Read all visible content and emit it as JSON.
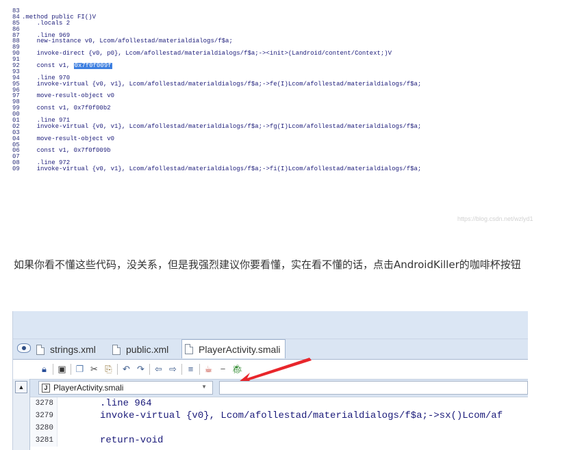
{
  "code_snippet": {
    "lines": [
      {
        "num": "83",
        "text": ""
      },
      {
        "num": "84",
        "text": ".method public FI()V"
      },
      {
        "num": "85",
        "text": "    .locals 2"
      },
      {
        "num": "86",
        "text": ""
      },
      {
        "num": "87",
        "text": "    .line 969"
      },
      {
        "num": "88",
        "text": "    new-instance v0, Lcom/afollestad/materialdialogs/f$a;"
      },
      {
        "num": "89",
        "text": ""
      },
      {
        "num": "90",
        "text": "    invoke-direct {v0, p0}, Lcom/afollestad/materialdialogs/f$a;-><init>(Landroid/content/Context;)V"
      },
      {
        "num": "91",
        "text": ""
      },
      {
        "num": "92",
        "text": "    const v1, ",
        "highlight": "0x7f0f009f"
      },
      {
        "num": "93",
        "text": ""
      },
      {
        "num": "94",
        "text": "    .line 970"
      },
      {
        "num": "95",
        "text": "    invoke-virtual {v0, v1}, Lcom/afollestad/materialdialogs/f$a;->fe(I)Lcom/afollestad/materialdialogs/f$a;"
      },
      {
        "num": "96",
        "text": ""
      },
      {
        "num": "97",
        "text": "    move-result-object v0"
      },
      {
        "num": "98",
        "text": ""
      },
      {
        "num": "99",
        "text": "    const v1, 0x7f0f00b2"
      },
      {
        "num": "00",
        "text": ""
      },
      {
        "num": "01",
        "text": "    .line 971"
      },
      {
        "num": "02",
        "text": "    invoke-virtual {v0, v1}, Lcom/afollestad/materialdialogs/f$a;->fg(I)Lcom/afollestad/materialdialogs/f$a;"
      },
      {
        "num": "03",
        "text": ""
      },
      {
        "num": "04",
        "text": "    move-result-object v0"
      },
      {
        "num": "05",
        "text": ""
      },
      {
        "num": "06",
        "text": "    const v1, 0x7f0f009b"
      },
      {
        "num": "07",
        "text": ""
      },
      {
        "num": "08",
        "text": "    .line 972"
      },
      {
        "num": "09",
        "text": "    invoke-virtual {v0, v1}, Lcom/afollestad/materialdialogs/f$a;->fi(I)Lcom/afollestad/materialdialogs/f$a;"
      }
    ],
    "watermark": "https://blog.csdn.net/wzlyd1"
  },
  "paragraph": "如果你看不懂这些代码，没关系，但是我强烈建议你要看懂，实在看不懂的话，点击AndroidKiller的咖啡杯按钮",
  "screenshot": {
    "tabs": [
      {
        "label": "strings.xml",
        "active": false
      },
      {
        "label": "public.xml",
        "active": false
      },
      {
        "label": "PlayerActivity.smali",
        "active": true
      }
    ],
    "file_combo": "PlayerActivity.smali",
    "editor_lines": [
      {
        "num": "3278",
        "text": ".line 964"
      },
      {
        "num": "3279",
        "text": "invoke-virtual {v0}, Lcom/afollestad/materialdialogs/f$a;->sx()Lcom/af"
      },
      {
        "num": "3280",
        "text": ""
      },
      {
        "num": "3281",
        "text": "return-void"
      }
    ],
    "toolbar_icons": [
      "lock-icon",
      "save-icon",
      "copy-icon",
      "cut-icon",
      "paste-icon",
      "undo-icon",
      "redo-icon",
      "back-icon",
      "forward-icon",
      "format-icon",
      "java-coffee-icon",
      "minus-icon",
      "bug-run-icon"
    ],
    "colors": {
      "accent_red": "#e8262b",
      "selection": "#3d7fe0",
      "panel_bg": "#dae5f3"
    }
  }
}
